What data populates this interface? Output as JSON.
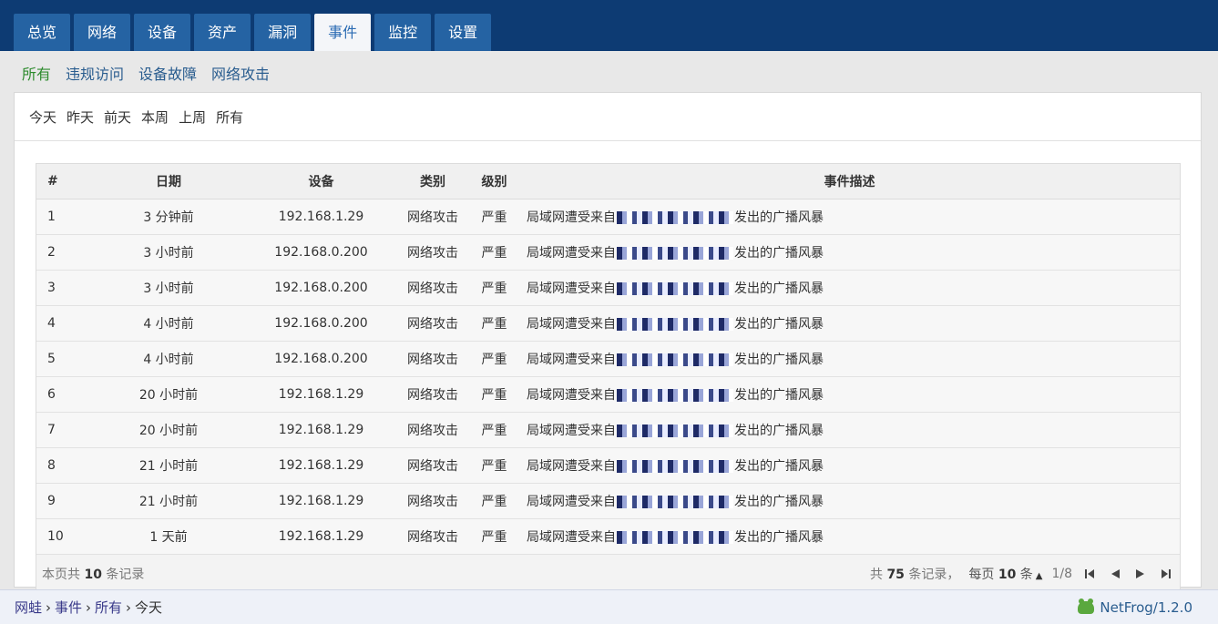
{
  "tabs": [
    "总览",
    "网络",
    "设备",
    "资产",
    "漏洞",
    "事件",
    "监控",
    "设置"
  ],
  "active_tab": "事件",
  "subnav": [
    "所有",
    "违规访问",
    "设备故障",
    "网络攻击"
  ],
  "date_filters": [
    "今天",
    "昨天",
    "前天",
    "本周",
    "上周",
    "所有"
  ],
  "table": {
    "headers": [
      "#",
      "日期",
      "设备",
      "类别",
      "级别",
      "事件描述"
    ],
    "rows": [
      {
        "idx": "1",
        "date": "3 分钟前",
        "device": "192.168.1.29",
        "category": "网络攻击",
        "level": "严重",
        "desc_prefix": "局域网遭受来自",
        "desc_suffix": "发出的广播风暴"
      },
      {
        "idx": "2",
        "date": "3 小时前",
        "device": "192.168.0.200",
        "category": "网络攻击",
        "level": "严重",
        "desc_prefix": "局域网遭受来自",
        "desc_suffix": "发出的广播风暴"
      },
      {
        "idx": "3",
        "date": "3 小时前",
        "device": "192.168.0.200",
        "category": "网络攻击",
        "level": "严重",
        "desc_prefix": "局域网遭受来自",
        "desc_suffix": "发出的广播风暴"
      },
      {
        "idx": "4",
        "date": "4 小时前",
        "device": "192.168.0.200",
        "category": "网络攻击",
        "level": "严重",
        "desc_prefix": "局域网遭受来自",
        "desc_suffix": "发出的广播风暴"
      },
      {
        "idx": "5",
        "date": "4 小时前",
        "device": "192.168.0.200",
        "category": "网络攻击",
        "level": "严重",
        "desc_prefix": "局域网遭受来自",
        "desc_suffix": "发出的广播风暴"
      },
      {
        "idx": "6",
        "date": "20 小时前",
        "device": "192.168.1.29",
        "category": "网络攻击",
        "level": "严重",
        "desc_prefix": "局域网遭受来自",
        "desc_suffix": "发出的广播风暴"
      },
      {
        "idx": "7",
        "date": "20 小时前",
        "device": "192.168.1.29",
        "category": "网络攻击",
        "level": "严重",
        "desc_prefix": "局域网遭受来自",
        "desc_suffix": "发出的广播风暴"
      },
      {
        "idx": "8",
        "date": "21 小时前",
        "device": "192.168.1.29",
        "category": "网络攻击",
        "level": "严重",
        "desc_prefix": "局域网遭受来自",
        "desc_suffix": "发出的广播风暴"
      },
      {
        "idx": "9",
        "date": "21 小时前",
        "device": "192.168.1.29",
        "category": "网络攻击",
        "level": "严重",
        "desc_prefix": "局域网遭受来自",
        "desc_suffix": "发出的广播风暴"
      },
      {
        "idx": "10",
        "date": "1 天前",
        "device": "192.168.1.29",
        "category": "网络攻击",
        "level": "严重",
        "desc_prefix": "局域网遭受来自",
        "desc_suffix": "发出的广播风暴"
      }
    ]
  },
  "footer": {
    "page_count_prefix": "本页共 ",
    "page_count": "10",
    "page_count_suffix": " 条记录",
    "total_prefix": "共 ",
    "total": "75",
    "total_suffix": " 条记录，",
    "per_page_prefix": "每页 ",
    "per_page": "10",
    "per_page_suffix": " 条",
    "page_indicator": "1/8"
  },
  "breadcrumb": [
    "网蛙",
    "事件",
    "所有"
  ],
  "breadcrumb_current": "今天",
  "brand": "NetFrog/1.2.0",
  "colors": {
    "topbar": "#0d3b73",
    "tab": "#2563a3",
    "active_sub": "#2e8b2e"
  }
}
